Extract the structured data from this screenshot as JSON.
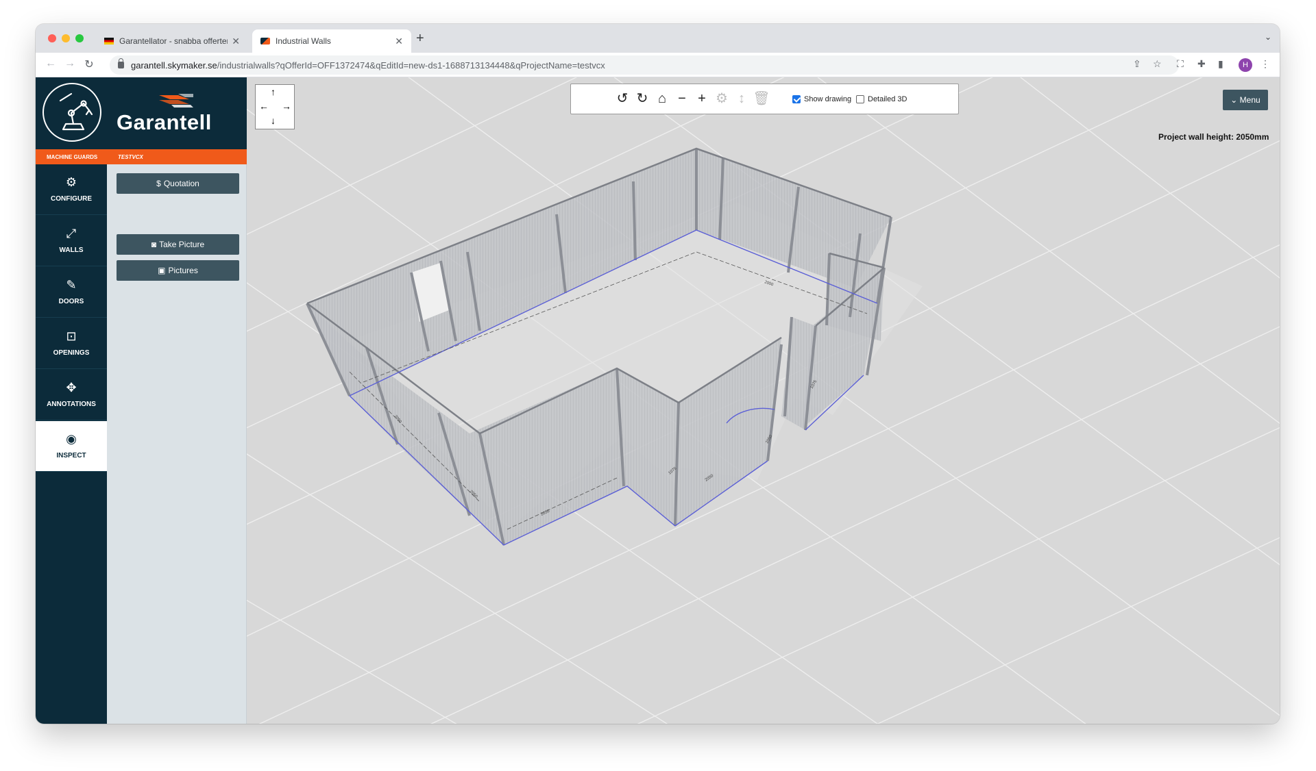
{
  "browser": {
    "tabs": [
      {
        "label": "Garantellator - snabba offerter",
        "active": false
      },
      {
        "label": "Industrial Walls",
        "active": true
      }
    ],
    "url_host": "garantell.skymaker.se",
    "url_path": "/industrialwalls?qOfferId=OFF1372474&qEditId=new-ds1-1688713134448&qProjectName=testvcx",
    "profile_initial": "H"
  },
  "brand": {
    "name": "Garantell",
    "category": "MACHINE GUARDS",
    "project": "TESTVCX"
  },
  "nav": [
    {
      "label": "CONFIGURE",
      "icon": "gear-icon"
    },
    {
      "label": "WALLS",
      "icon": "resize-arrows-icon"
    },
    {
      "label": "DOORS",
      "icon": "edit-square-icon"
    },
    {
      "label": "OPENINGS",
      "icon": "square-opening-icon"
    },
    {
      "label": "ANNOTATIONS",
      "icon": "crosshair-arrows-icon"
    },
    {
      "label": "INSPECT",
      "icon": "eye-icon"
    }
  ],
  "panel": {
    "quotation_label": "Quotation",
    "take_picture_label": "Take Picture",
    "pictures_label": "Pictures"
  },
  "viewer": {
    "show_drawing_label": "Show drawing",
    "show_drawing_checked": true,
    "detailed_3d_label": "Detailed 3D",
    "detailed_3d_checked": false,
    "menu_label": "Menu",
    "wall_height_text": "Project wall height: 2050mm",
    "dimension_labels": [
      "2050",
      "2050",
      "2050",
      "1075",
      "2050",
      "2050",
      "1075",
      "2050"
    ]
  },
  "colors": {
    "brand_navy": "#0c2b3a",
    "brand_orange": "#f05a1a",
    "button_slate": "#3d5560",
    "checkbox_blue": "#1a73e8"
  }
}
